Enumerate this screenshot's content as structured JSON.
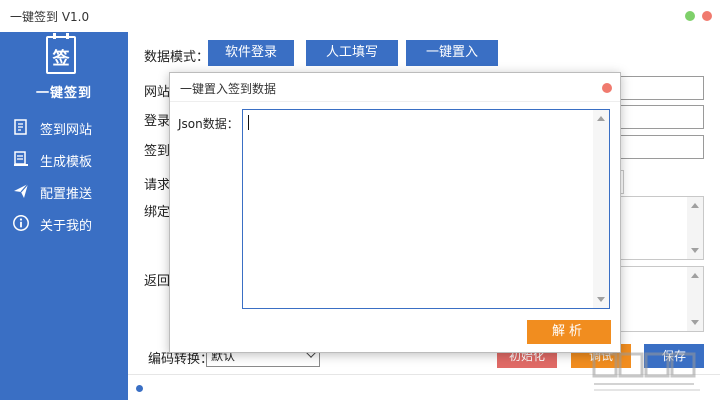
{
  "window": {
    "title": "一键签到 V1.0",
    "controls": [
      {
        "name": "minimize",
        "color": "#7ed06a"
      },
      {
        "name": "close",
        "color": "#f07a6e"
      }
    ]
  },
  "sidebar": {
    "logo_char": "签",
    "app_name": "一键签到",
    "items": [
      {
        "label": "签到网站",
        "icon": "edit-icon"
      },
      {
        "label": "生成模板",
        "icon": "template-icon"
      },
      {
        "label": "配置推送",
        "icon": "send-icon"
      },
      {
        "label": "关于我的",
        "icon": "info-icon"
      }
    ]
  },
  "main": {
    "mode_label": "数据模式：",
    "mode_buttons": [
      "软件登录",
      "人工填写",
      "一键置入"
    ],
    "row_labels": [
      "网站",
      "登录",
      "签到",
      "请求",
      "绑定",
      "返回"
    ],
    "encoding_label": "编码转换：",
    "encoding_value": "默认",
    "buttons": {
      "init": "初始化",
      "debug": "调试",
      "save": "保存"
    }
  },
  "dialog": {
    "title": "一键置入签到数据",
    "json_label": "Json数据：",
    "json_value": "",
    "parse_label": "解析"
  },
  "colors": {
    "primary": "#3a6fc4",
    "accent": "#f18d1f",
    "danger": "#e06a66"
  }
}
